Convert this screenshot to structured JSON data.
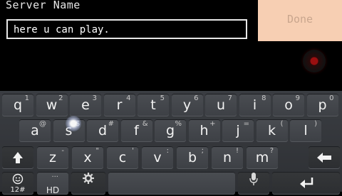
{
  "form": {
    "server_label": "Server Name",
    "server_value": "here u can play.",
    "done_label": "Done"
  },
  "keyboard": {
    "row1": [
      {
        "k": "q",
        "h": "1"
      },
      {
        "k": "w",
        "h": "2"
      },
      {
        "k": "e",
        "h": "3"
      },
      {
        "k": "r",
        "h": "4"
      },
      {
        "k": "t",
        "h": "5"
      },
      {
        "k": "y",
        "h": "6"
      },
      {
        "k": "u",
        "h": "7"
      },
      {
        "k": "i",
        "h": "8"
      },
      {
        "k": "o",
        "h": "9"
      },
      {
        "k": "p",
        "h": "0"
      }
    ],
    "row2": [
      {
        "k": "a",
        "h": "@"
      },
      {
        "k": "s",
        "h": "$"
      },
      {
        "k": "d",
        "h": "#"
      },
      {
        "k": "f",
        "h": "&"
      },
      {
        "k": "g",
        "h": "%"
      },
      {
        "k": "h",
        "h": "+"
      },
      {
        "k": "j",
        "h": "="
      },
      {
        "k": "k",
        "h": "("
      },
      {
        "k": "l",
        "h": ")"
      }
    ],
    "row3": [
      {
        "k": "z",
        "h": "-"
      },
      {
        "k": "x",
        "h": "\""
      },
      {
        "k": "c",
        "h": "'"
      },
      {
        "k": "v",
        "h": ":"
      },
      {
        "k": "b",
        "h": ";"
      },
      {
        "k": "n",
        "h": "!"
      },
      {
        "k": "m",
        "h": "?"
      }
    ],
    "numbers_label": "12#",
    "period_label": "HD",
    "period_hint": "..."
  },
  "icons": {
    "shift": "shift-arrow-icon",
    "backspace": "backspace-icon",
    "emoji": "smiley-icon",
    "settings": "gear-icon",
    "mic": "microphone-icon",
    "enter": "enter-icon"
  }
}
